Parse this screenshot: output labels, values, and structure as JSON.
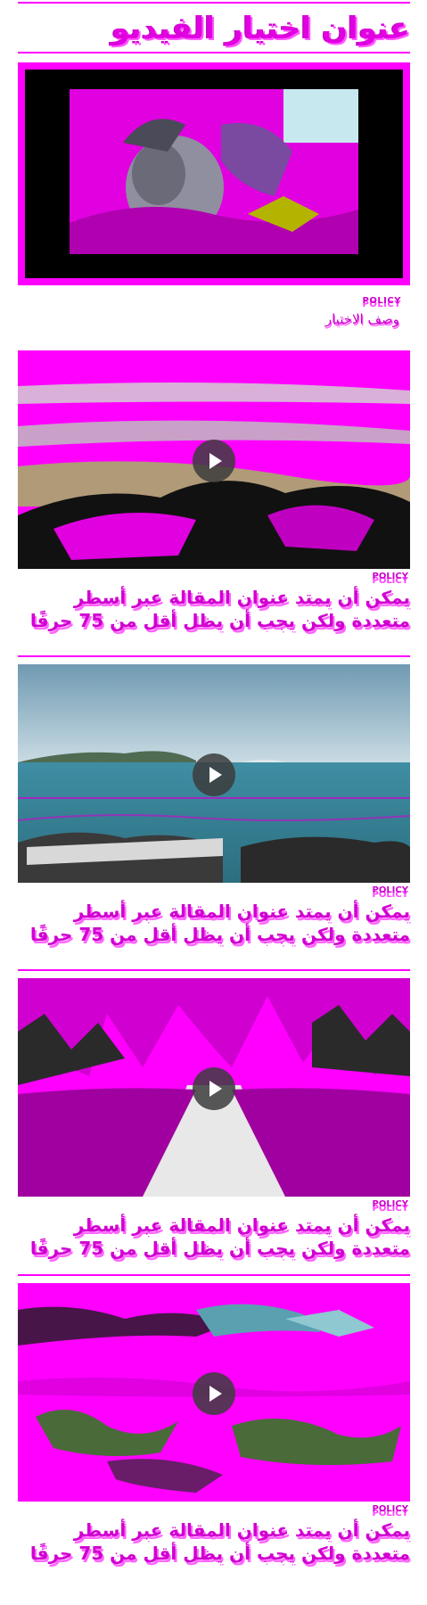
{
  "page": {
    "title": "عنوان اختيار الفيديو"
  },
  "featured": {
    "label": "POLICY",
    "description": "وصف الاختيار"
  },
  "cards": [
    {
      "tag": "POLICY",
      "headline": "يمكن أن يمتد عنوان المقالة عبر أسطر متعددة ولكن يجب أن يظل أقل من 75 حرفًا"
    },
    {
      "tag": "POLICY",
      "headline": "يمكن أن يمتد عنوان المقالة عبر أسطر متعددة ولكن يجب أن يظل أقل من 75 حرفًا"
    },
    {
      "tag": "POLICY",
      "headline": "يمكن أن يمتد عنوان المقالة عبر أسطر متعددة ولكن يجب أن يظل أقل من 75 حرفًا"
    },
    {
      "tag": "POLICY",
      "headline": "يمكن أن يمتد عنوان المقالة عبر أسطر متعددة ولكن يجب أن يظل أقل من 75 حرفًا"
    }
  ],
  "icons": {
    "play": "play-icon"
  },
  "colors": {
    "accent": "#ff00ff",
    "text": "#d400d4",
    "overlay": "#3c3c3c"
  }
}
